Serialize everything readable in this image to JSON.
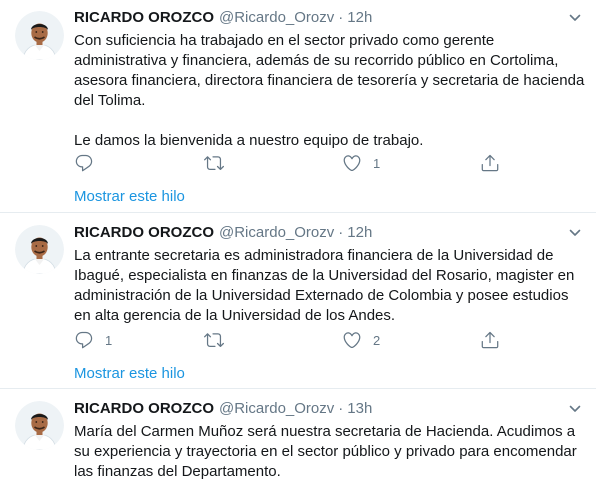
{
  "tweets": [
    {
      "name": "RICARDO OROZCO",
      "handle": "@Ricardo_Orozv",
      "separator": "·",
      "time": "12h",
      "lines": [
        "Con suficiencia ha trabajado en el sector privado como gerente",
        "administrativa y financiera, además de su recorrido público en Cortolima,",
        "asesora financiera, directora financiera de tesorería y secretaria de hacienda",
        "del Tolima.",
        "",
        "Le damos la bienvenida a nuestro equipo de trabajo."
      ],
      "actions": {
        "reply_count": "",
        "retweet_count": "",
        "like_count": "1",
        "share_count": ""
      },
      "thread_link": "Mostrar este hilo"
    },
    {
      "name": "RICARDO OROZCO",
      "handle": "@Ricardo_Orozv",
      "separator": "·",
      "time": "12h",
      "lines": [
        "La entrante secretaria es administradora financiera de la Universidad de",
        "Ibagué, especialista en finanzas de la Universidad del Rosario, magister en",
        "administración de la Universidad Externado de Colombia y posee estudios",
        "en alta gerencia de la Universidad de los Andes."
      ],
      "actions": {
        "reply_count": "1",
        "retweet_count": "",
        "like_count": "2",
        "share_count": ""
      },
      "thread_link": "Mostrar este hilo"
    },
    {
      "name": "RICARDO OROZCO",
      "handle": "@Ricardo_Orozv",
      "separator": "·",
      "time": "13h",
      "lines": [
        "María del Carmen Muñoz será nuestra secretaria de Hacienda. Acudimos a",
        "su experiencia y trayectoria en el sector público y privado para encomendar",
        "las finanzas del Departamento."
      ]
    }
  ],
  "colors": {
    "text": "#14171a",
    "secondary": "#657786",
    "link": "#1b95e0",
    "divider": "#e6ecf0"
  },
  "icons": {
    "reply": "reply-icon",
    "retweet": "retweet-icon",
    "like": "heart-icon",
    "share": "share-icon",
    "more": "chevron-down-icon"
  }
}
